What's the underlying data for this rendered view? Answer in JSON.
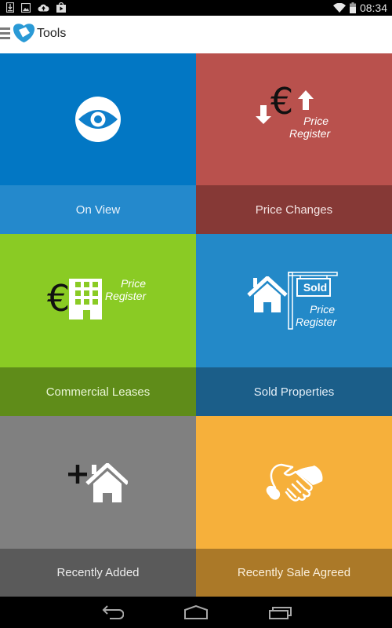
{
  "status_bar": {
    "left_icons": [
      "download-icon",
      "image-icon",
      "cloud-upload-icon",
      "play-store-icon"
    ],
    "right_icons": [
      "wifi-icon",
      "battery-icon"
    ],
    "time": "08:34"
  },
  "action_bar": {
    "menu_icon": "hamburger-menu-icon",
    "logo_icon": "app-logo-icon",
    "title": "Tools"
  },
  "tiles": [
    {
      "label": "On View",
      "icon": "eye-icon",
      "art_color": "#0277c4",
      "label_color": "#2489cc",
      "text_color": "#e8f2fb"
    },
    {
      "label": "Price Changes",
      "icon": "price-changes-icon",
      "art_text": "Price Register",
      "art_color": "#b9514d",
      "label_color": "#863936",
      "text_color": "#f4e4e3"
    },
    {
      "label": "Commercial Leases",
      "icon": "commercial-building-icon",
      "art_text": "Price Register",
      "art_color": "#8acb24",
      "label_color": "#5f8c19",
      "text_color": "#eaf6d6"
    },
    {
      "label": "Sold Properties",
      "icon": "sold-sign-icon",
      "art_text": "Price Register",
      "sign_text": "Sold",
      "art_color": "#2389c8",
      "label_color": "#1b5e89",
      "text_color": "#e3eef7"
    },
    {
      "label": "Recently Added",
      "icon": "add-house-icon",
      "art_color": "#808080",
      "label_color": "#5a5a5a",
      "text_color": "#eeeeee"
    },
    {
      "label": "Recently Sale Agreed",
      "icon": "handshake-icon",
      "art_color": "#f6b03b",
      "label_color": "#ab7928",
      "text_color": "#fbf0dc"
    }
  ],
  "nav_bar": {
    "back": "back-icon",
    "home": "home-icon",
    "recents": "recent-apps-icon"
  }
}
